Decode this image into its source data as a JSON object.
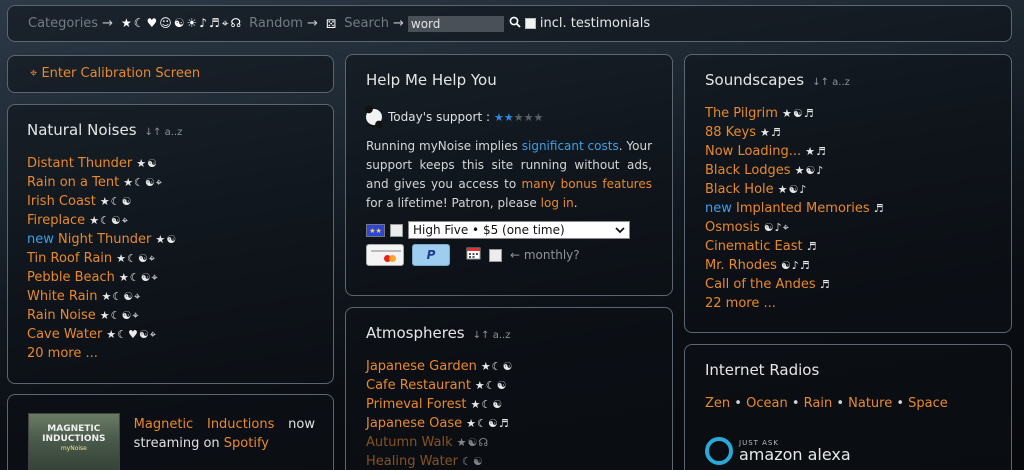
{
  "topbar": {
    "categories_label": "Categories",
    "category_icons": "★☾♥☺☯☀♪♬⌖☊",
    "random_label": "Random",
    "random_icon": "⚄",
    "search_label": "Search",
    "search_value": "word",
    "search_icon": "magnifier-icon",
    "testimonials_label": "incl. testimonials"
  },
  "calibration": {
    "icon": "⌖",
    "label": "Enter Calibration Screen"
  },
  "natural": {
    "title": "Natural Noises",
    "sort": "↓↑ a..z",
    "items": [
      {
        "prefix": "",
        "name": "Distant Thunder",
        "icons": "★☯"
      },
      {
        "prefix": "",
        "name": "Rain on a Tent",
        "icons": "★☾☯⌖"
      },
      {
        "prefix": "",
        "name": "Irish Coast",
        "icons": "★☾☯"
      },
      {
        "prefix": "",
        "name": "Fireplace",
        "icons": "★☾☯⌖"
      },
      {
        "prefix": "new",
        "name": "Night Thunder",
        "icons": "★☯"
      },
      {
        "prefix": "",
        "name": "Tin Roof Rain",
        "icons": "★☾☯⌖"
      },
      {
        "prefix": "",
        "name": "Pebble Beach",
        "icons": "★☾☯⌖"
      },
      {
        "prefix": "",
        "name": "White Rain",
        "icons": "★☾☯⌖"
      },
      {
        "prefix": "",
        "name": "Rain Noise",
        "icons": "★☾☯⌖"
      },
      {
        "prefix": "",
        "name": "Cave Water",
        "icons": "★☾♥☯⌖"
      }
    ],
    "more": "20 more ..."
  },
  "help": {
    "title": "Help Me Help You",
    "support_label": "Today's support :",
    "stars_on": "★★",
    "stars_off": "★★★",
    "text_1": "Running myNoise implies ",
    "link_costs": "significant costs",
    "text_2": ". Your support keeps this site running without ads, and gives you access to ",
    "link_bonus": "many bonus features",
    "text_3": " for a lifetime! Patron, please ",
    "link_login": "log in",
    "text_4": ".",
    "tier_selected": "High Five • $5 (one time)",
    "paypal": "P",
    "monthly": "← monthly?"
  },
  "atmospheres": {
    "title": "Atmospheres",
    "sort": "↓↑ a..z",
    "items": [
      {
        "name": "Japanese Garden",
        "icons": "★☾☯",
        "dim": false
      },
      {
        "name": "Cafe Restaurant",
        "icons": "★☾☯",
        "dim": false
      },
      {
        "name": "Primeval Forest",
        "icons": "★☾☯",
        "dim": false
      },
      {
        "name": "Japanese Oase",
        "icons": "★☾☯♬",
        "dim": false
      },
      {
        "name": "Autumn Walk",
        "icons": "★☯☊",
        "dim": true
      },
      {
        "name": "Healing Water",
        "icons": "☾☯",
        "dim": true
      }
    ]
  },
  "soundscapes": {
    "title": "Soundscapes",
    "sort": "↓↑ a..z",
    "items": [
      {
        "prefix": "",
        "name": "The Pilgrim",
        "icons": "★☯♬"
      },
      {
        "prefix": "",
        "name": "88 Keys",
        "icons": "★♬"
      },
      {
        "prefix": "",
        "name": "Now Loading...",
        "icons": "★♬"
      },
      {
        "prefix": "",
        "name": "Black Lodges",
        "icons": "★☯♪"
      },
      {
        "prefix": "",
        "name": "Black Hole",
        "icons": "★☯♪"
      },
      {
        "prefix": "new",
        "name": "Implanted Memories",
        "icons": "♬"
      },
      {
        "prefix": "",
        "name": "Osmosis",
        "icons": "☯♪⌖"
      },
      {
        "prefix": "",
        "name": "Cinematic East",
        "icons": "♬"
      },
      {
        "prefix": "",
        "name": "Mr. Rhodes",
        "icons": "☯♪♬"
      },
      {
        "prefix": "",
        "name": "Call of the Andes",
        "icons": "♬"
      }
    ],
    "more": "22 more ..."
  },
  "radios": {
    "title": "Internet Radios",
    "links": [
      "Zen",
      "Ocean",
      "Rain",
      "Nature",
      "Space"
    ],
    "separator": " • ",
    "alexa_small": "JUST ASK",
    "alexa_big": "amazon alexa"
  },
  "magnetic": {
    "album_title": "MAGNETIC INDUCTIONS",
    "album_sub": "myNoise",
    "link_title": "Magnetic Inductions",
    "text_now": " now streaming on ",
    "link_spotify": "Spotify"
  },
  "colors": {
    "accent": "#e8892c",
    "new_blue": "#3e9fe6",
    "border": "#5b6672"
  }
}
